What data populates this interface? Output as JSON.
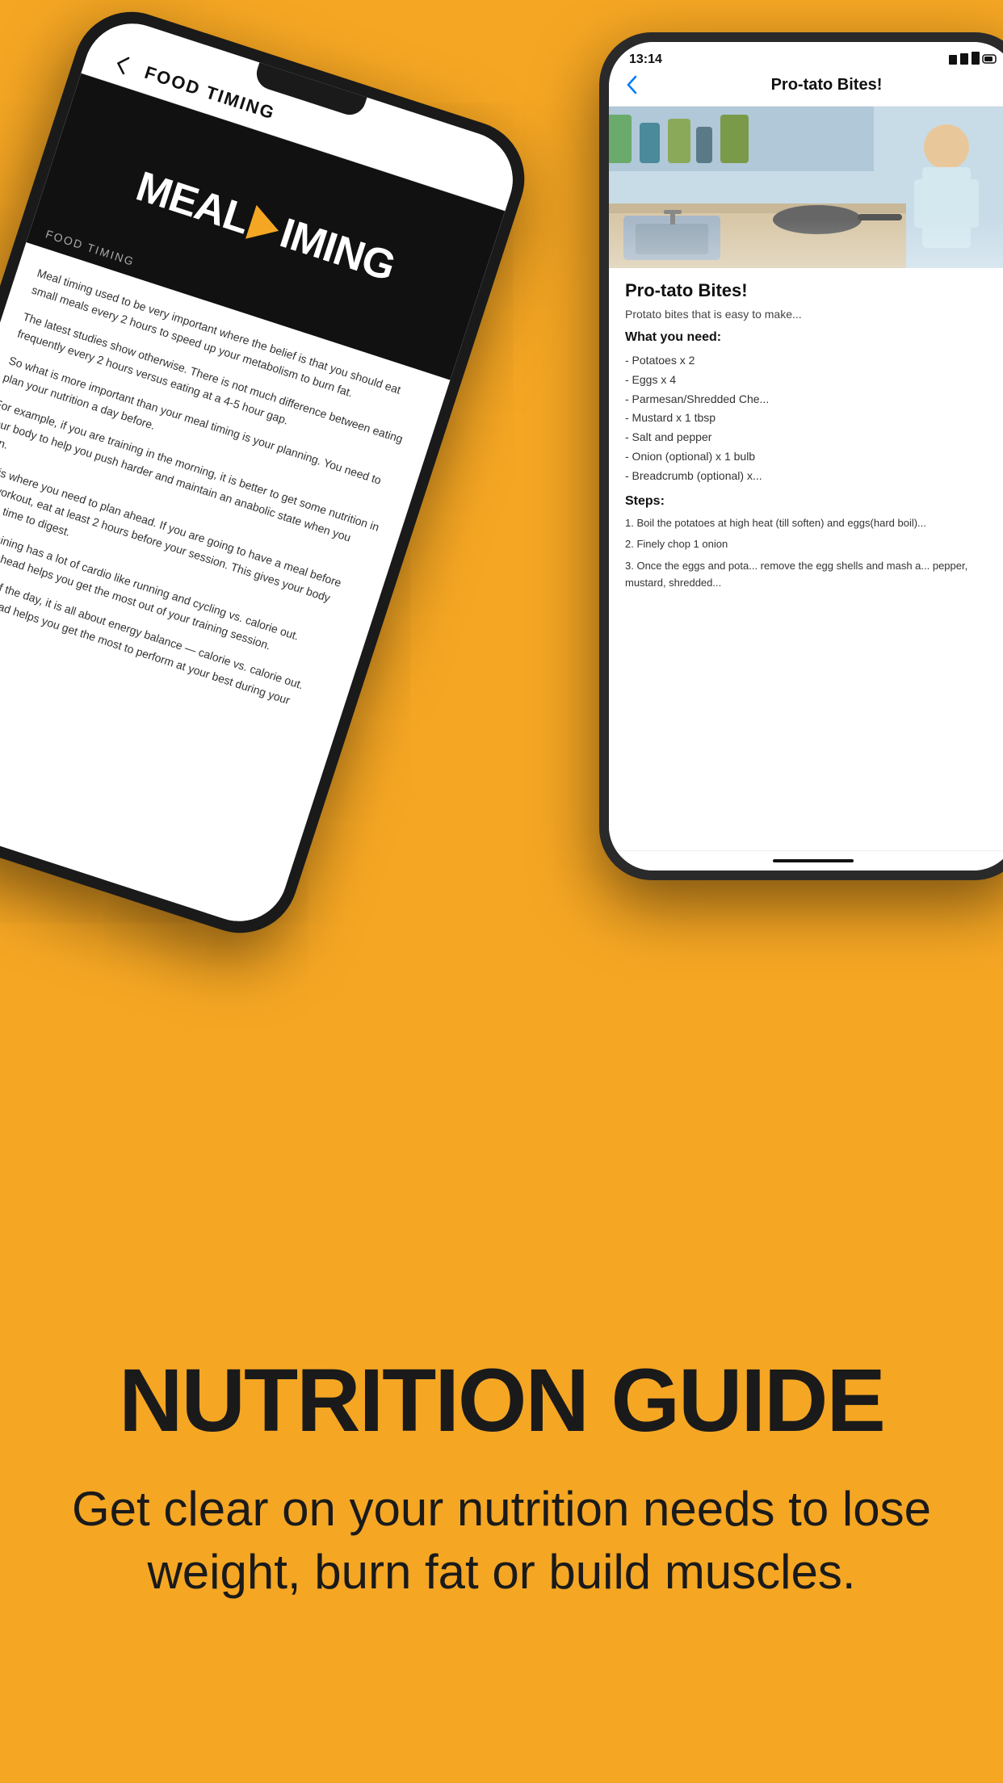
{
  "background_color": "#F5A623",
  "phones_area": {
    "left_phone": {
      "header": {
        "back_label": "‹",
        "title": "FOOD TIMING"
      },
      "video": {
        "label": "FOOD TIMING",
        "title_part1": "MEAL ",
        "title_part2": "IMING"
      },
      "content": {
        "paragraph1": "Meal timing used to be very important where the belief is that you should eat small meals every 2 hours to speed up your metabolism to burn fat.",
        "paragraph2": "The latest studies show otherwise. There is not much difference between eating frequently every 2 hours versus eating at a 4-5 hour gap.",
        "paragraph3": "So what is more important than your meal timing is your planning. You need to plan your nutrition a day before.",
        "paragraph4": "For example, if you are training in the morning, it is better to get some nutrition in your body to help you push harder and maintain an anabolic state when you train.",
        "paragraph5": "This is where you need to plan ahead. If you are going to have a meal before your workout, eat at least 2 hours before your session. This gives your body enough time to digest.",
        "paragraph6": "If your training has a lot of cardio like running and cycling vs. calorie out. Planning ahead helps you get the most out of your training session.",
        "paragraph7": "At the end of the day, it is all about energy balance — calorie vs. calorie out. Planning ahead helps you get the most to perform at your best during your workout."
      }
    },
    "right_phone": {
      "status_bar": {
        "time": "13:14",
        "signal": "●●●"
      },
      "header": {
        "back_label": "‹",
        "title": "Pro-tato Bites!"
      },
      "recipe": {
        "title": "Pro-tato Bites!",
        "intro": "Protato bites that is easy to make...",
        "what_you_need_label": "What you need:",
        "ingredients": [
          "- Potatoes x 2",
          "- Eggs x 4",
          "- Parmesan/Shredded Cheese",
          "- Mustard x 1 tbsp",
          "- Salt and pepper",
          "- Onion (optional) x 1 bulb",
          "- Breadcrumb (optional) x..."
        ],
        "steps_label": "Steps:",
        "steps": [
          "1. Boil the potatoes at high heat (till soften) and eggs(hard boil)...",
          "2. Finely chop 1 onion",
          "3. Once the eggs and pota... remove the egg shells and mash a... pepper, mustard, shredded..."
        ]
      }
    }
  },
  "bottom_section": {
    "title": "NUTRITION GUIDE",
    "subtitle": "Get clear on your nutrition needs to lose weight, burn fat or build muscles."
  }
}
